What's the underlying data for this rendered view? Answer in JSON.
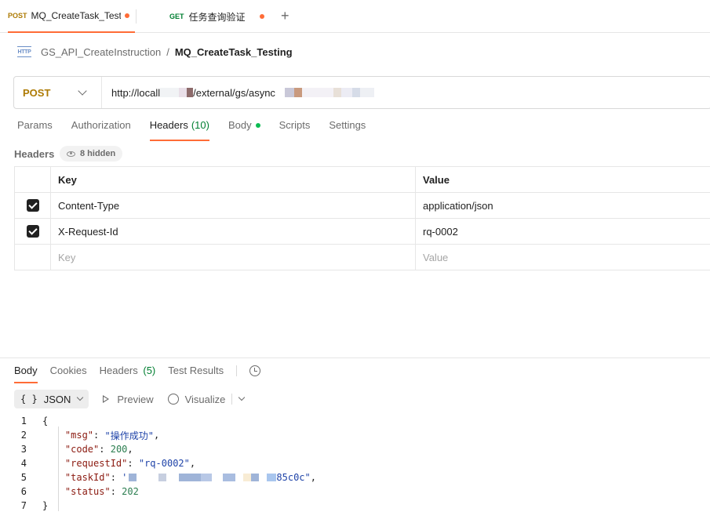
{
  "tabs": [
    {
      "method": "POST",
      "title": "MQ_CreateTask_Testing",
      "unsaved": true
    },
    {
      "method": "GET",
      "title": "任务查询验证",
      "unsaved": true
    }
  ],
  "new_tab_label": "+",
  "breadcrumb": {
    "icon_text": "HTTP",
    "parent": "GS_API_CreateInstruction",
    "separator": "/",
    "current": "MQ_CreateTask_Testing"
  },
  "request": {
    "method": "POST",
    "url_start": "http://locall",
    "url_path": "/external/gs/async"
  },
  "request_tabs": {
    "params": "Params",
    "authorization": "Authorization",
    "headers": "Headers",
    "headers_count": "(10)",
    "body": "Body",
    "scripts": "Scripts",
    "settings": "Settings"
  },
  "headers_section": {
    "label": "Headers",
    "hidden": "8 hidden",
    "col_key": "Key",
    "col_value": "Value",
    "rows": [
      {
        "key": "Content-Type",
        "value": "application/json"
      },
      {
        "key": "X-Request-Id",
        "value": "rq-0002"
      }
    ],
    "placeholder_key": "Key",
    "placeholder_value": "Value"
  },
  "response_tabs": {
    "body": "Body",
    "cookies": "Cookies",
    "headers": "Headers",
    "headers_count": "(5)",
    "test_results": "Test Results"
  },
  "format": {
    "braces": "{ }",
    "selected": "JSON",
    "preview": "Preview",
    "visualize": "Visualize"
  },
  "response_body": {
    "line_numbers": [
      "1",
      "2",
      "3",
      "4",
      "5",
      "6",
      "7"
    ],
    "open": "{",
    "close": "}",
    "msg_key": "\"msg\"",
    "msg_val": "\"操作成功\"",
    "code_key": "\"code\"",
    "code_val": "200",
    "requestId_key": "\"requestId\"",
    "requestId_val": "\"rq-0002\"",
    "taskId_key": "\"taskId\"",
    "taskId_val_start": "'",
    "taskId_val_end": "85c0c\"",
    "status_key": "\"status\"",
    "status_val": "202"
  },
  "colors": {
    "accent": "#ff6c37",
    "post": "#ad7a03",
    "get": "#007f31",
    "json_key": "#8b1a10",
    "json_string": "#1f43a8",
    "json_number": "#2a7d4f"
  }
}
